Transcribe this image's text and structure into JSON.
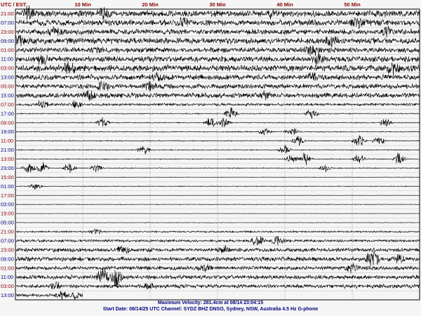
{
  "header": {
    "corner_label": "UTC / EST",
    "minute_ticks": [
      "10 Min",
      "20 Min",
      "30 Min",
      "40 Min",
      "50 Min"
    ]
  },
  "footer": {
    "line1": "Maximum Velocity: 281.4cm at 08/14 23:04:15",
    "line2": "Start Date: 08/14/25 UTC Channel: SYDZ  BHZ  DNSO, Sydney, NSW, Australia  4.5 Hz G-phone"
  },
  "colors": {
    "utc_label": "#8b0000",
    "est_label": "#000080",
    "trace": "#000000",
    "grid": "#c8c8c8",
    "minute_divider": "#777777",
    "background": "#f5f5f5",
    "header_text": "#8b0000",
    "footer_text": "#000080"
  },
  "chart_data": {
    "type": "helicorder",
    "x_axis": {
      "label": "Min",
      "range_min": [
        0,
        60
      ],
      "ticks": [
        10,
        20,
        30,
        40,
        50
      ]
    },
    "left_labels": [
      {
        "utc": "21:00",
        "est": "07:00"
      },
      {
        "utc": "23:00",
        "est": "09:00"
      },
      {
        "utc": "01:00",
        "est": "11:00"
      },
      {
        "utc": "03:00",
        "est": "13:00"
      },
      {
        "utc": "05:00",
        "est": "15:00"
      },
      {
        "utc": "07:00",
        "est": "17:00"
      },
      {
        "utc": "09:00",
        "est": "19:00"
      },
      {
        "utc": "11:00",
        "est": "21:00"
      },
      {
        "utc": "13:00",
        "est": "23:00"
      },
      {
        "utc": "15:00",
        "est": "01:00"
      },
      {
        "utc": "17:00",
        "est": "03:00"
      },
      {
        "utc": "19:00",
        "est": "05:00"
      },
      {
        "utc": "21:00",
        "est": "07:00"
      },
      {
        "utc": "23:00",
        "est": "09:00"
      },
      {
        "utc": "01:00",
        "est": "11:00"
      },
      {
        "utc": "03:00",
        "est": "13:00"
      }
    ],
    "hourly_traces": [
      {
        "amp": 1.0,
        "bursts": [
          [
            2,
            0.6
          ],
          [
            13,
            0.5
          ],
          [
            38,
            0.3
          ]
        ],
        "end_min": 60
      },
      {
        "amp": 0.95,
        "bursts": [
          [
            25,
            0.3
          ],
          [
            51,
            0.4
          ]
        ],
        "end_min": 60
      },
      {
        "amp": 0.85,
        "bursts": [
          [
            6,
            0.3
          ],
          [
            55,
            0.4
          ]
        ],
        "end_min": 60
      },
      {
        "amp": 0.95,
        "bursts": [
          [
            0.5,
            0.5
          ],
          [
            47,
            0.5
          ]
        ],
        "end_min": 60
      },
      {
        "amp": 0.8,
        "bursts": [
          [
            12,
            0.3
          ],
          [
            44,
            0.6
          ]
        ],
        "end_min": 60
      },
      {
        "amp": 0.9,
        "bursts": [
          [
            4,
            0.4
          ],
          [
            45,
            0.5
          ]
        ],
        "end_min": 60
      },
      {
        "amp": 1.0,
        "bursts": [
          [
            8,
            0.6
          ],
          [
            56,
            0.5
          ]
        ],
        "end_min": 60
      },
      {
        "amp": 0.85,
        "bursts": [
          [
            21,
            0.3
          ],
          [
            44,
            0.4
          ]
        ],
        "end_min": 60
      },
      {
        "amp": 0.75,
        "bursts": [
          [
            13,
            0.5
          ],
          [
            20,
            0.4
          ]
        ],
        "end_min": 60
      },
      {
        "amp": 0.8,
        "bursts": [
          [
            11,
            0.5
          ],
          [
            37,
            0.3
          ]
        ],
        "end_min": 60
      },
      {
        "amp": 0.4,
        "bursts": [
          [
            4,
            0.4
          ],
          [
            9,
            0.4
          ]
        ],
        "end_min": 60
      },
      {
        "amp": 0.15,
        "bursts": [
          [
            32,
            0.6
          ],
          [
            44,
            0.5
          ]
        ],
        "end_min": 60
      },
      {
        "amp": 0.15,
        "bursts": [
          [
            13,
            0.5
          ],
          [
            29,
            0.6
          ],
          [
            31,
            0.5
          ],
          [
            55,
            0.5
          ]
        ],
        "end_min": 60
      },
      {
        "amp": 0.15,
        "bursts": [
          [
            37,
            0.4
          ],
          [
            41,
            0.5
          ]
        ],
        "end_min": 60
      },
      {
        "amp": 0.15,
        "bursts": [
          [
            42,
            0.5
          ],
          [
            51,
            0.6
          ],
          [
            54,
            0.5
          ]
        ],
        "end_min": 60
      },
      {
        "amp": 0.15,
        "bursts": [
          [
            19,
            0.5
          ],
          [
            40,
            0.4
          ]
        ],
        "end_min": 60
      },
      {
        "amp": 0.15,
        "bursts": [
          [
            41,
            0.5
          ],
          [
            43,
            0.6
          ],
          [
            51,
            0.5
          ],
          [
            57,
            0.6
          ]
        ],
        "end_min": 60
      },
      {
        "amp": 0.15,
        "bursts": [
          [
            2,
            0.6
          ],
          [
            4,
            0.5
          ],
          [
            8,
            0.5
          ],
          [
            12,
            0.4
          ],
          [
            46,
            0.3
          ]
        ],
        "end_min": 60
      },
      {
        "amp": 0.08,
        "bursts": [],
        "end_min": 60
      },
      {
        "amp": 0.12,
        "bursts": [
          [
            3,
            0.3
          ]
        ],
        "end_min": 60
      },
      {
        "amp": 0.05,
        "bursts": [],
        "end_min": 60
      },
      {
        "amp": 0.1,
        "bursts": [],
        "end_min": 60
      },
      {
        "amp": 0.05,
        "bursts": [],
        "end_min": 60
      },
      {
        "amp": 0.08,
        "bursts": [],
        "end_min": 60
      },
      {
        "amp": 0.25,
        "bursts": [
          [
            12,
            0.3
          ]
        ],
        "end_min": 60
      },
      {
        "amp": 0.4,
        "bursts": [
          [
            36,
            0.5
          ],
          [
            39,
            0.4
          ]
        ],
        "end_min": 60
      },
      {
        "amp": 0.6,
        "bursts": [
          [
            16,
            0.4
          ],
          [
            31,
            0.4
          ]
        ],
        "end_min": 60
      },
      {
        "amp": 0.7,
        "bursts": [
          [
            53,
            1.0
          ],
          [
            57,
            0.4
          ]
        ],
        "end_min": 60
      },
      {
        "amp": 0.6,
        "bursts": [
          [
            28,
            0.3
          ],
          [
            50,
            0.4
          ]
        ],
        "end_min": 60
      },
      {
        "amp": 0.65,
        "bursts": [
          [
            13,
            0.9
          ],
          [
            15,
            0.8
          ]
        ],
        "end_min": 60
      },
      {
        "amp": 0.6,
        "bursts": [
          [
            6,
            0.4
          ],
          [
            20,
            0.3
          ]
        ],
        "end_min": 60
      },
      {
        "amp": 0.5,
        "bursts": [
          [
            7,
            0.3
          ],
          [
            9,
            0.3
          ]
        ],
        "end_min": 10
      }
    ]
  }
}
